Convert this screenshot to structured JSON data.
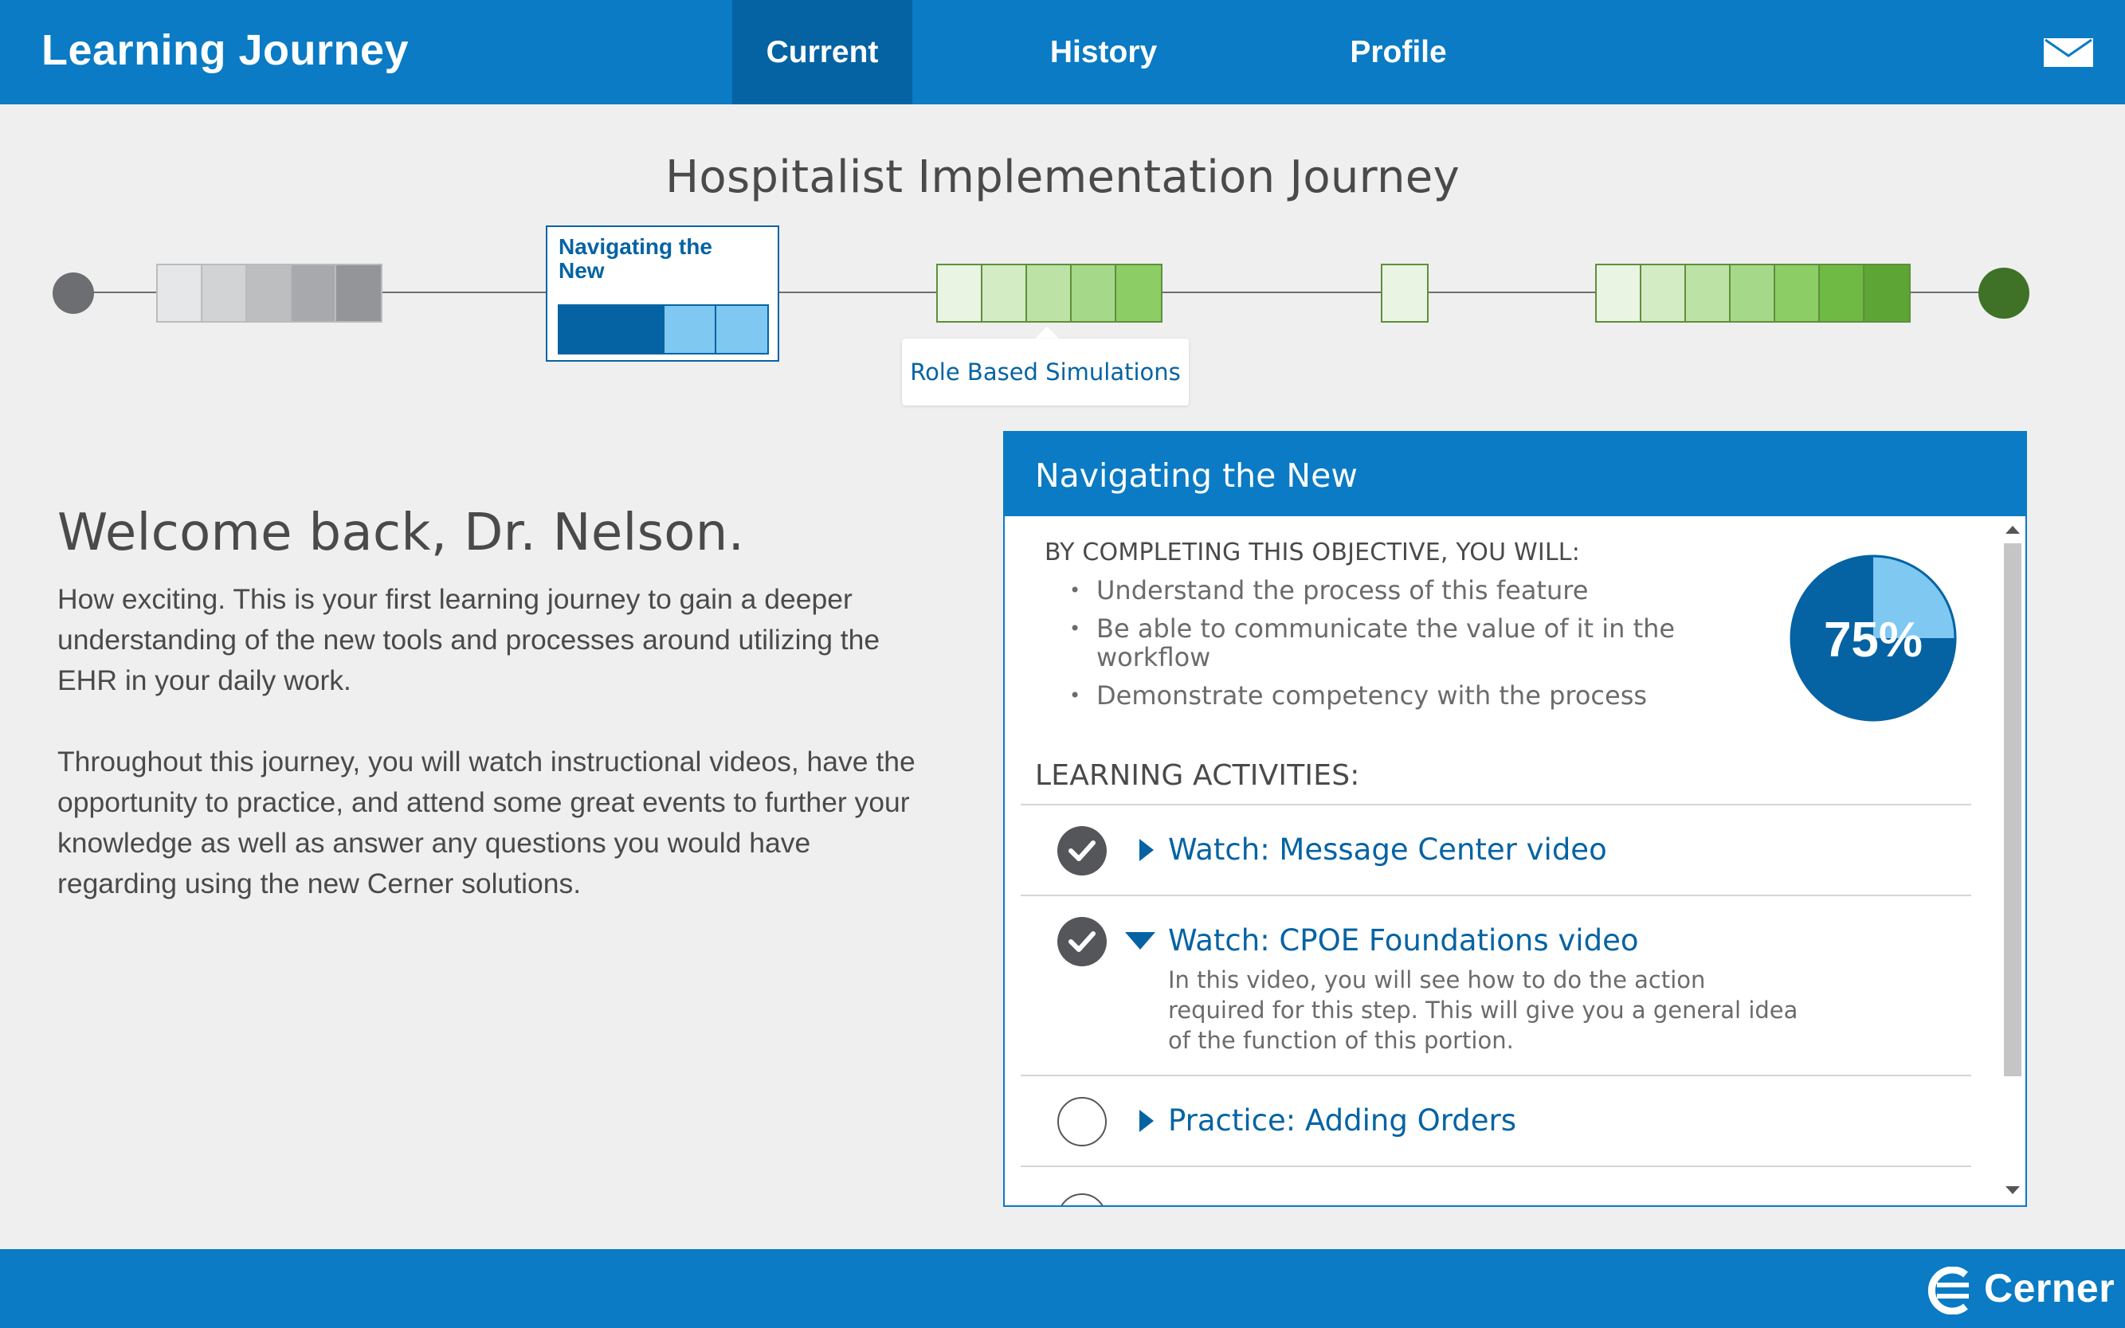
{
  "header": {
    "title": "Learning Journey",
    "tabs": [
      {
        "label": "Current",
        "active": true
      },
      {
        "label": "History",
        "active": false
      },
      {
        "label": "Profile",
        "active": false
      }
    ],
    "icon": "mail-icon"
  },
  "journey": {
    "title": "Hospitalist Implementation Journey",
    "current_step_label": "Navigating the New",
    "current_step_progress": 0.5,
    "tooltip": "Role Based Simulations",
    "segments": [
      {
        "name": "completed-gray",
        "cells": [
          "#e6e7e8",
          "#d1d3d4",
          "#bcbec0",
          "#a7a9ac",
          "#939598"
        ]
      },
      {
        "name": "current",
        "cells": [
          "#0563a3",
          "#0563a3",
          "#7ec8f2",
          "#7ec8f2"
        ]
      },
      {
        "name": "role-based-simulations",
        "cells": [
          "#e9f4e2",
          "#d3ecc4",
          "#bde2a6",
          "#a6d889",
          "#8ccd66"
        ]
      },
      {
        "name": "single",
        "cells": [
          "#e9f4e2"
        ]
      },
      {
        "name": "final",
        "cells": [
          "#e9f4e2",
          "#d3ecc4",
          "#bde2a6",
          "#a6d889",
          "#8ccd66",
          "#6fba44",
          "#5da535"
        ]
      }
    ]
  },
  "welcome": {
    "heading": "Welcome back, Dr. Nelson.",
    "paragraph1": "How exciting. This is your first learning journey to gain a deeper understanding of the new tools and processes around utilizing the EHR in your daily work.",
    "paragraph2": "Throughout this journey, you will watch instructional videos, have the opportunity to practice, and attend some great events to further your knowledge as well as answer any questions you would have regarding using the new Cerner solutions."
  },
  "panel": {
    "title": "Navigating the New",
    "objective_heading": "BY COMPLETING THIS OBJECTIVE, YOU WILL:",
    "objectives": [
      "Understand the process of this feature",
      "Be able to communicate the value of it in the workflow",
      "Demonstrate competency with the process"
    ],
    "progress": {
      "percent": 75,
      "label": "75%"
    },
    "activities_heading": "LEARNING ACTIVITIES:",
    "activities": [
      {
        "label": "Watch: Message Center video",
        "completed": true,
        "expanded": false
      },
      {
        "label": "Watch: CPOE Foundations video",
        "completed": true,
        "expanded": true,
        "description": "In this video, you will see how to do the action required for this step. This will give you a general idea of the function of this portion."
      },
      {
        "label": "Practice: Adding Orders",
        "completed": false,
        "expanded": false
      }
    ]
  },
  "footer": {
    "brand": "Cerner"
  },
  "colors": {
    "primary": "#0a7bc4",
    "primary_dark": "#0563a3",
    "light_blue": "#7ec8f2",
    "green_dark": "#3f7226"
  }
}
